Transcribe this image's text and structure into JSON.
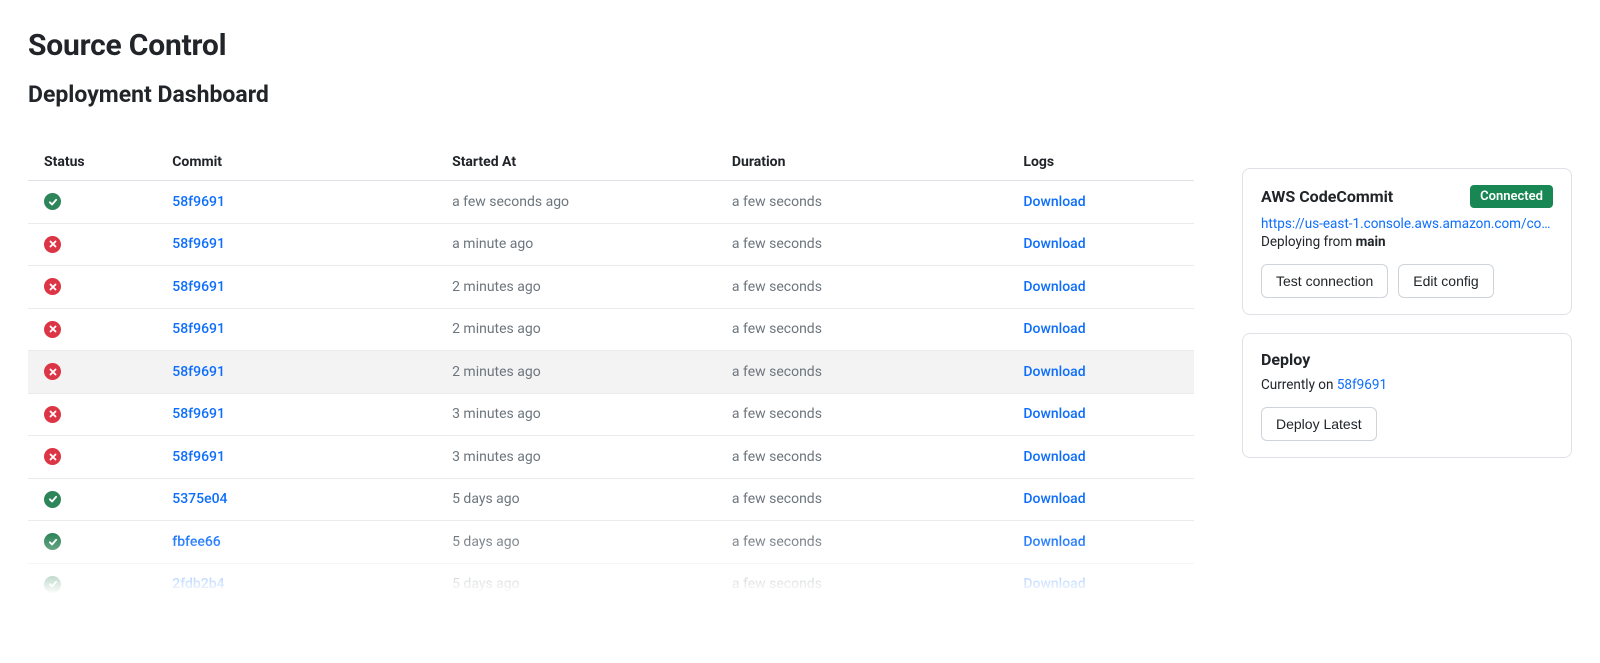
{
  "page_title": "Source Control",
  "dashboard_title": "Deployment Dashboard",
  "table": {
    "headers": {
      "status": "Status",
      "commit": "Commit",
      "started_at": "Started At",
      "duration": "Duration",
      "logs": "Logs"
    },
    "log_link_label": "Download",
    "rows": [
      {
        "status": "success",
        "commit": "58f9691",
        "started_at": "a few seconds ago",
        "duration": "a few seconds"
      },
      {
        "status": "fail",
        "commit": "58f9691",
        "started_at": "a minute ago",
        "duration": "a few seconds"
      },
      {
        "status": "fail",
        "commit": "58f9691",
        "started_at": "2 minutes ago",
        "duration": "a few seconds"
      },
      {
        "status": "fail",
        "commit": "58f9691",
        "started_at": "2 minutes ago",
        "duration": "a few seconds"
      },
      {
        "status": "fail",
        "commit": "58f9691",
        "started_at": "2 minutes ago",
        "duration": "a few seconds",
        "hovered": true
      },
      {
        "status": "fail",
        "commit": "58f9691",
        "started_at": "3 minutes ago",
        "duration": "a few seconds"
      },
      {
        "status": "fail",
        "commit": "58f9691",
        "started_at": "3 minutes ago",
        "duration": "a few seconds"
      },
      {
        "status": "success",
        "commit": "5375e04",
        "started_at": "5 days ago",
        "duration": "a few seconds"
      },
      {
        "status": "success",
        "commit": "fbfee66",
        "started_at": "5 days ago",
        "duration": "a few seconds"
      },
      {
        "status": "success",
        "commit": "2fdb2b4",
        "started_at": "5 days ago",
        "duration": "a few seconds"
      }
    ]
  },
  "codecommit_card": {
    "title": "AWS CodeCommit",
    "badge": "Connected",
    "url_display": "https://us-east-1.console.aws.amazon.com/code...",
    "deploy_from_prefix": "Deploying from ",
    "deploy_from_branch": "main",
    "test_connection_label": "Test connection",
    "edit_config_label": "Edit config"
  },
  "deploy_card": {
    "title": "Deploy",
    "current_prefix": "Currently on ",
    "current_commit": "58f9691",
    "deploy_latest_label": "Deploy Latest"
  }
}
